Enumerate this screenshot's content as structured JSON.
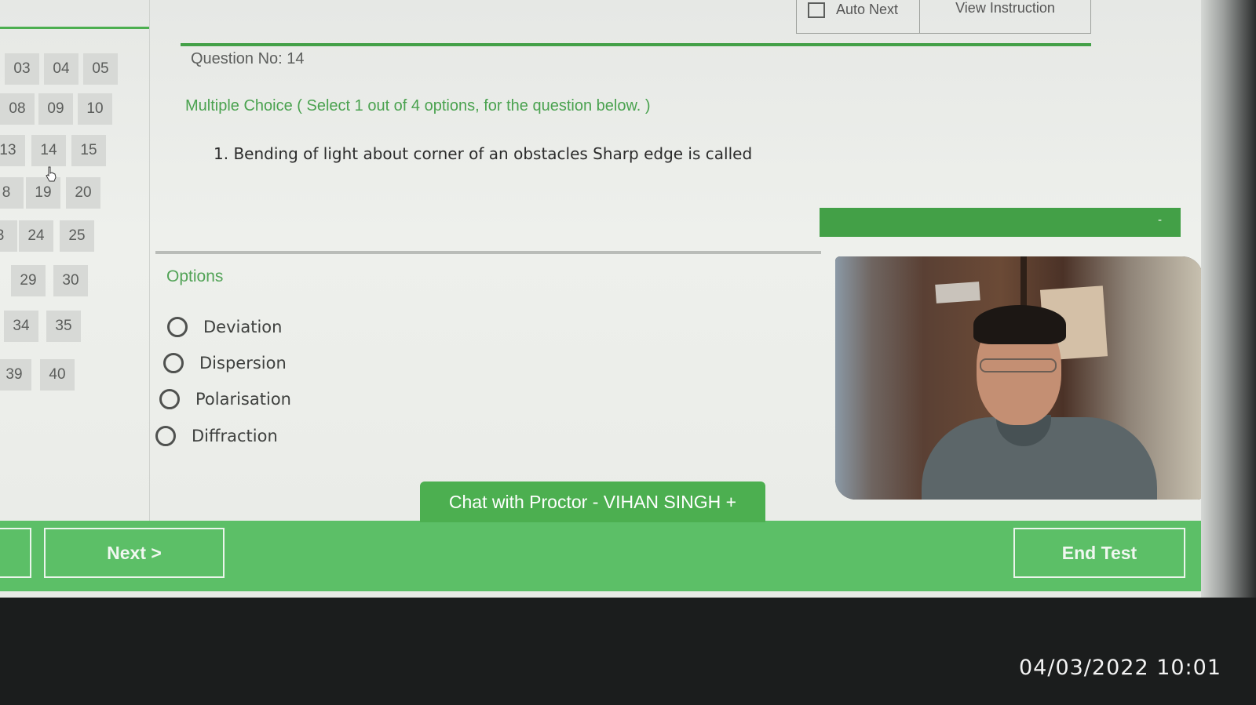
{
  "question_grid": {
    "rows": [
      [
        "03",
        "04",
        "05"
      ],
      [
        "08",
        "09",
        "10"
      ],
      [
        "13",
        "14",
        "15"
      ],
      [
        "8",
        "19",
        "20"
      ],
      [
        "3",
        "24",
        "25"
      ],
      [
        "29",
        "30"
      ],
      [
        "34",
        "35"
      ],
      [
        "39",
        "40"
      ]
    ]
  },
  "top_bar": {
    "auto_next_label": "Auto Next",
    "view_instruction_label": "View Instruction"
  },
  "question": {
    "number_label": "Question No: 14",
    "type_description": "Multiple Choice ( Select 1 out of 4 options, for the question below. )",
    "text": "1. Bending of light about corner of an obstacles Sharp edge is called"
  },
  "options": {
    "title": "Options",
    "items": [
      "Deviation",
      "Dispersion",
      "Polarisation",
      "Diffraction"
    ]
  },
  "proctor": {
    "minimize_label": "-",
    "chat_label": "Chat with Proctor - VIHAN SINGH  +"
  },
  "footer": {
    "next_label": "Next >",
    "end_label": "End Test"
  },
  "photo_timestamp": "04/03/2022 10:01"
}
